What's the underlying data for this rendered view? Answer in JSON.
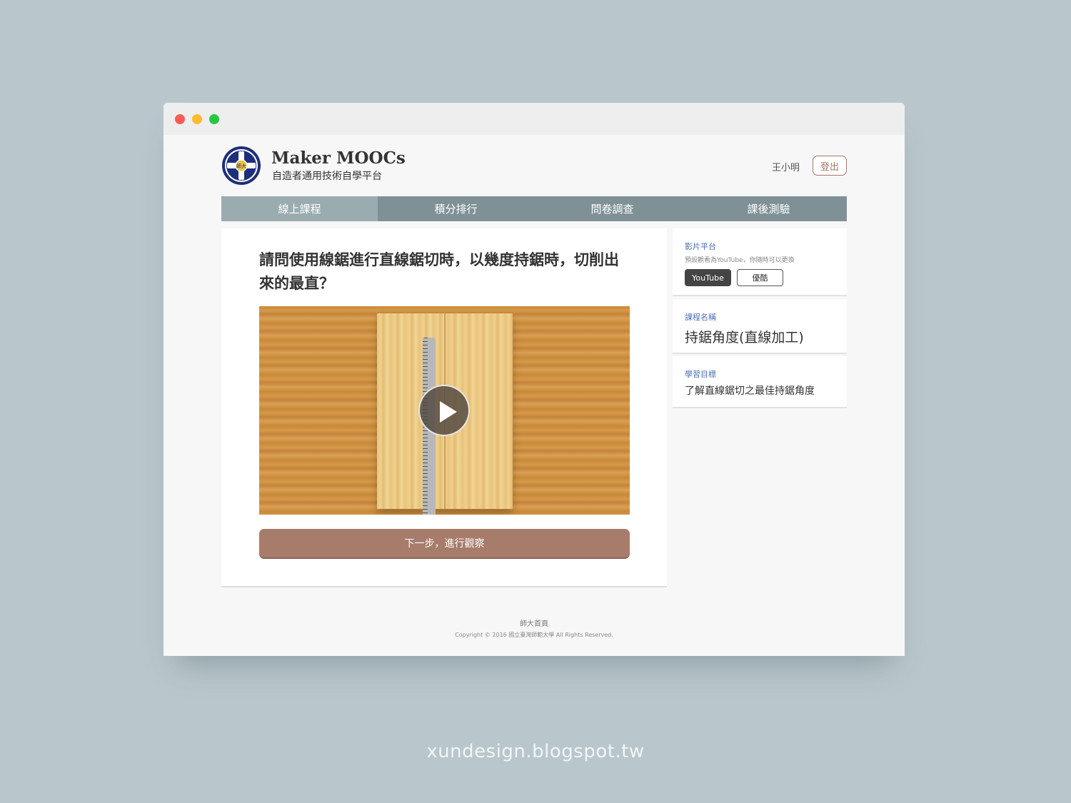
{
  "header": {
    "title": "Maker MOOCs",
    "subtitle": "自造者通用技術自學平台",
    "user_name": "王小明",
    "logout_label": "登出",
    "logo_text": "師大"
  },
  "nav": {
    "items": [
      "線上課程",
      "積分排行",
      "問卷調查",
      "課後測驗"
    ],
    "active_index": 0
  },
  "main": {
    "question": "請問使用線鋸進行直線鋸切時，以幾度持鋸時，切削出來的最直？",
    "next_label": "下一步，進行觀察"
  },
  "sidebar": {
    "platform": {
      "label": "影片平台",
      "note": "預設觀看為YouTube，你隨時可以更換",
      "options": [
        "YouTube",
        "優酷"
      ],
      "selected": "YouTube"
    },
    "course": {
      "label": "課程名稱",
      "name": "持鋸角度(直線加工)"
    },
    "objective": {
      "label": "學習目標",
      "text": "了解直線鋸切之最佳持鋸角度"
    }
  },
  "footer": {
    "link": "師大首頁",
    "copyright": "Copyright © 2016 國立臺灣師範大學 All Rights Reserved."
  },
  "watermark": "xundesign.blogspot.tw",
  "colors": {
    "nav_bg": "#7f9196",
    "nav_active": "#9aacb0",
    "accent_brown": "#a77c6b",
    "label_blue": "#4a6fb5"
  }
}
